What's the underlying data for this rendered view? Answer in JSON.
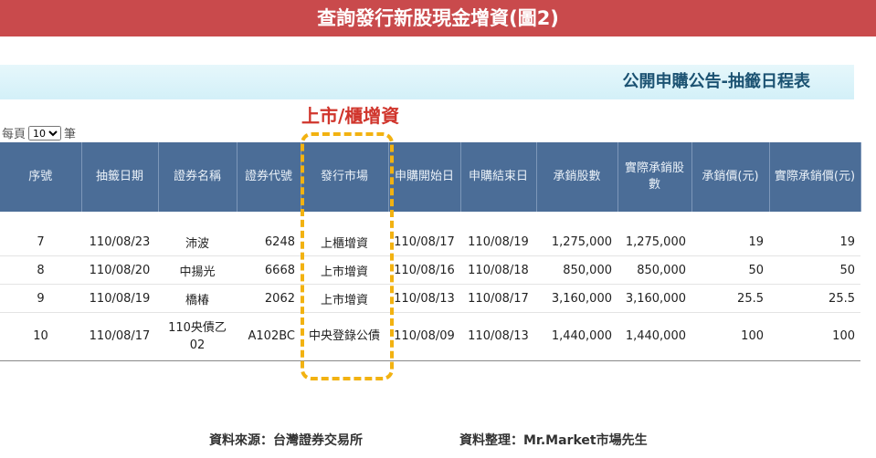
{
  "banner": {
    "title": "查詢發行新股現金增資(圖2)"
  },
  "subheader": {
    "title": "公開申購公告-抽籤日程表"
  },
  "annotation": {
    "text": "上市/櫃增資"
  },
  "pagination": {
    "prefix": "每頁",
    "value": "10",
    "suffix": "筆"
  },
  "table": {
    "headers": [
      "序號",
      "抽籤日期",
      "證券名稱",
      "證券代號",
      "發行市場",
      "申購開始日",
      "申購結束日",
      "承銷股數",
      "實際承銷股數",
      "承銷價(元)",
      "實際承銷價(元)"
    ],
    "rows": [
      [
        "7",
        "110/08/23",
        "沛波",
        "6248",
        "上櫃增資",
        "110/08/17",
        "110/08/19",
        "1,275,000",
        "1,275,000",
        "19",
        "19"
      ],
      [
        "8",
        "110/08/20",
        "中揚光",
        "6668",
        "上市增資",
        "110/08/16",
        "110/08/18",
        "850,000",
        "850,000",
        "50",
        "50"
      ],
      [
        "9",
        "110/08/19",
        "橋椿",
        "2062",
        "上市增資",
        "110/08/13",
        "110/08/17",
        "3,160,000",
        "3,160,000",
        "25.5",
        "25.5"
      ],
      [
        "10",
        "110/08/17",
        "110央債乙02",
        "A102BC",
        "中央登錄公債",
        "110/08/09",
        "110/08/13",
        "1,440,000",
        "1,440,000",
        "100",
        "100"
      ]
    ]
  },
  "footer": {
    "source": "資料來源：台灣證券交易所",
    "compiler": "資料整理：Mr.Market市場先生"
  },
  "colors": {
    "banner": "#c94a4c",
    "header": "#4b6d97",
    "annotation": "#d0352c",
    "dash": "#f2b211"
  }
}
